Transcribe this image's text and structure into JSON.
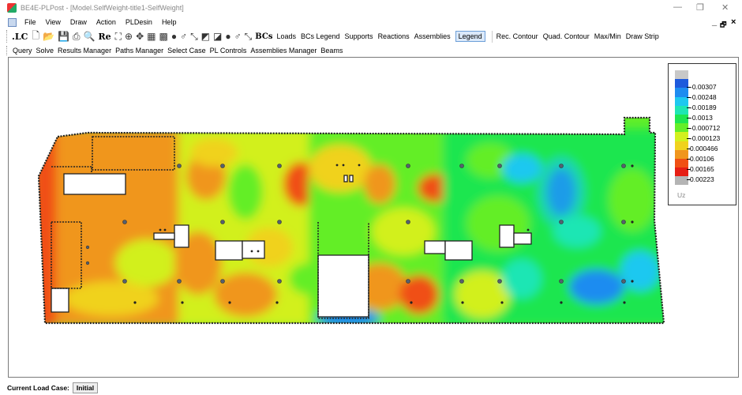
{
  "window": {
    "title": "BE4E-PLPost - [Model.SelfWeight-title1-SelfWeight]",
    "minimize": "—",
    "restore": "❐",
    "close": "✕"
  },
  "menu": {
    "items": [
      "File",
      "View",
      "Draw",
      "Action",
      "PLDesin",
      "Help"
    ],
    "mdi_minimize": "_",
    "mdi_restore": "🗗",
    "mdi_close": "×"
  },
  "toolbar1": {
    "lc_label": ".LC",
    "re_label": "Re",
    "bcs_label": "BCs",
    "text_buttons": [
      "Loads",
      "BCs Legend",
      "Supports",
      "Reactions",
      "Assemblies",
      "Legend",
      "Rec. Contour",
      "Quad. Contour",
      "Max/Min",
      "Draw Strip"
    ],
    "pressed": "Legend"
  },
  "toolbar2": {
    "items": [
      "Query",
      "Solve",
      "Results Manager",
      "Paths Manager",
      "Select Case",
      "PL Controls",
      "Assemblies Manager",
      "Beams"
    ]
  },
  "legend": {
    "labels": [
      "-0.00307",
      "-0.00248",
      "-0.00189",
      "-0.0013",
      "-0.000712",
      "-0.000123",
      "0.000466",
      "0.00106",
      "0.00165",
      "0.00223"
    ],
    "colors": [
      "#c8c8c8",
      "#1e5adc",
      "#1e8cf0",
      "#1ec8f0",
      "#1ee6b4",
      "#1ee650",
      "#64ee28",
      "#d2f01e",
      "#f0d21e",
      "#f0961e",
      "#f05014",
      "#e61e14",
      "#b4b4b4"
    ],
    "unit": "Uz"
  },
  "status": {
    "label": "Current Load Case:",
    "value": "Initial"
  }
}
